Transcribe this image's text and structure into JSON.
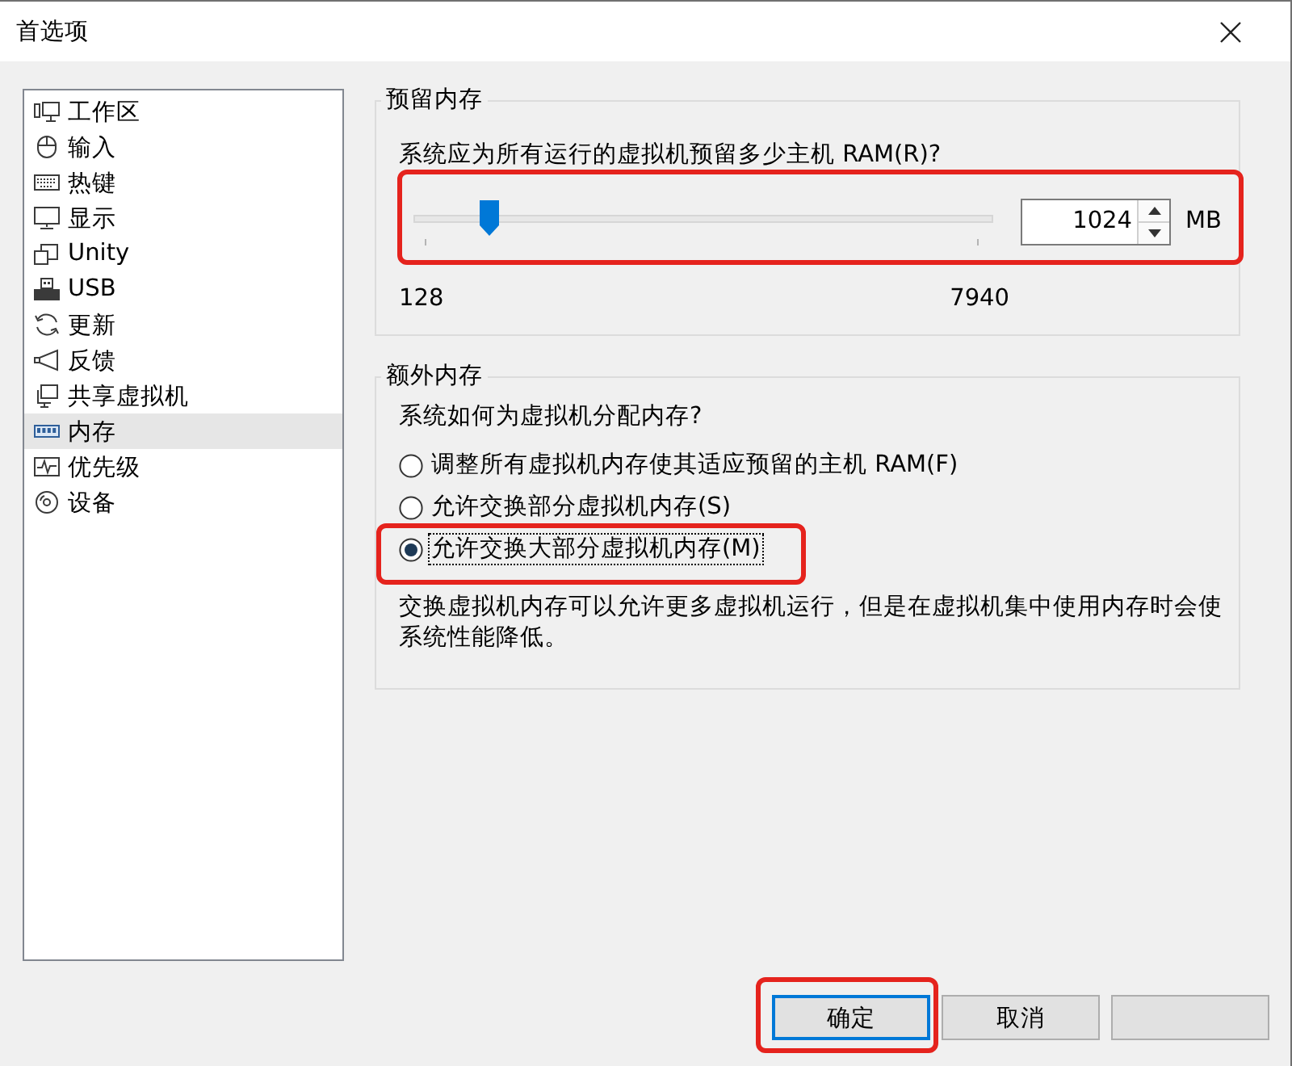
{
  "window": {
    "title": "首选项"
  },
  "sidebar": {
    "items": [
      {
        "label": "工作区",
        "selected": false
      },
      {
        "label": "输入",
        "selected": false
      },
      {
        "label": "热键",
        "selected": false
      },
      {
        "label": "显示",
        "selected": false
      },
      {
        "label": "Unity",
        "selected": false
      },
      {
        "label": "USB",
        "selected": false
      },
      {
        "label": "更新",
        "selected": false
      },
      {
        "label": "反馈",
        "selected": false
      },
      {
        "label": "共享虚拟机",
        "selected": false
      },
      {
        "label": "内存",
        "selected": true
      },
      {
        "label": "优先级",
        "selected": false
      },
      {
        "label": "设备",
        "selected": false
      }
    ]
  },
  "reserve": {
    "title": "预留内存",
    "question": "系统应为所有运行的虚拟机预留多少主机 RAM(R)?",
    "level": 0.13,
    "value": "1024",
    "unit": "MB",
    "min_label": "128",
    "max_label": "7940",
    "highlighted": true
  },
  "extra": {
    "title": "额外内存",
    "question": "系统如何为虚拟机分配内存?",
    "options": [
      {
        "label": "调整所有虚拟机内存使其适应预留的主机 RAM(F)",
        "selected": false,
        "focused": false,
        "highlighted": false
      },
      {
        "label": "允许交换部分虚拟机内存(S)",
        "selected": false,
        "focused": false,
        "highlighted": false
      },
      {
        "label": "允许交换大部分虚拟机内存(M)",
        "selected": true,
        "focused": true,
        "highlighted": true
      }
    ],
    "description": "交换虚拟机内存可以允许更多虚拟机运行，但是在虚拟机集中使用内存时会使系统性能降低。"
  },
  "buttons": [
    {
      "label": "确定",
      "default": true,
      "highlighted": true
    },
    {
      "label": "取消",
      "default": false,
      "highlighted": false
    },
    {
      "default": false,
      "highlighted": false
    }
  ]
}
